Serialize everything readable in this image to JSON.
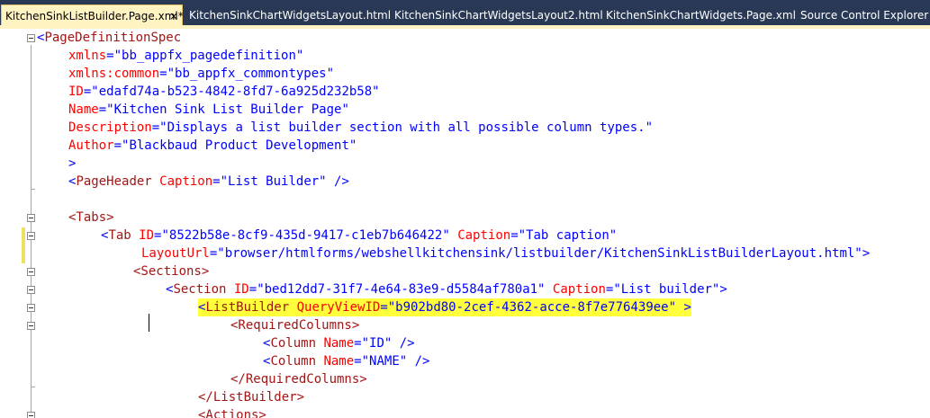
{
  "tabs": [
    {
      "label": "KitchenSinkListBuilder.Page.xml*",
      "active": true
    },
    {
      "label": "KitchenSinkChartWidgetsLayout.html"
    },
    {
      "label": "KitchenSinkChartWidgetsLayout2.html"
    },
    {
      "label": "KitchenSinkChartWidgets.Page.xml"
    },
    {
      "label": "Source Control Explorer"
    }
  ],
  "tab_close_glyph": "×",
  "code": {
    "l1_open": "<",
    "l1_tag": "PageDefinitionSpec",
    "l2_attr": "xmlns",
    "l2_eq": "=",
    "l2_val": "\"bb_appfx_pagedefinition\"",
    "l3_attr": "xmlns:common",
    "l3_eq": "=",
    "l3_val": "\"bb_appfx_commontypes\"",
    "l4_attr": "ID",
    "l4_eq": "=",
    "l4_val": "\"edafd74a-b523-4842-8fd7-6a925d232b58\"",
    "l5_attr": "Name",
    "l5_eq": "=",
    "l5_val": "\"Kitchen Sink List Builder Page\"",
    "l6_attr": "Description",
    "l6_eq": "=",
    "l6_val": "\"Displays a list builder section with all possible column types.\"",
    "l7_attr": "Author",
    "l7_eq": "=",
    "l7_val": "\"Blackbaud Product Development\"",
    "l8_close": ">",
    "l9_open": "<",
    "l9_tag": "PageHeader",
    "l9_attr": " Caption",
    "l9_eq": "=",
    "l9_val": "\"List Builder\"",
    "l9_end": " />",
    "l11_text": "<Tabs>",
    "l12_open": "<",
    "l12_tag": "Tab",
    "l12_attr1": " ID",
    "l12_eq1": "=",
    "l12_val1": "\"8522b58e-8cf9-435d-9417-c1eb7b646422\"",
    "l12_attr2": " Caption",
    "l12_eq2": "=",
    "l12_val2": "\"Tab caption\"",
    "l13_attr": "LayoutUrl",
    "l13_eq": "=",
    "l13_val": "\"browser/htmlforms/webshellkitchensink/listbuilder/KitchenSinkListBuilderLayout.html\"",
    "l13_end": ">",
    "l14_text": "<Sections>",
    "l15_open": "<",
    "l15_tag": "Section",
    "l15_attr1": " ID",
    "l15_eq1": "=",
    "l15_val1": "\"bed12dd7-31f7-4e64-83e9-d5584af780a1\"",
    "l15_attr2": " Caption",
    "l15_eq2": "=",
    "l15_val2": "\"List builder\"",
    "l15_end": ">",
    "l16_open": "<",
    "l16_tag": "ListBuilder",
    "l16_attr": " QueryViewID",
    "l16_eq": "=",
    "l16_val": "\"b902bd80-2cef-4362-acce-8f7e776439ee\"",
    "l16_end": " >",
    "l17_text": "<RequiredColumns>",
    "l18_open": "<",
    "l18_tag": "Column",
    "l18_attr": " Name",
    "l18_eq": "=",
    "l18_val": "\"ID\"",
    "l18_end": " />",
    "l19_open": "<",
    "l19_tag": "Column",
    "l19_attr": " Name",
    "l19_eq": "=",
    "l19_val": "\"NAME\"",
    "l19_end": " />",
    "l20_text": "</RequiredColumns>",
    "l21_text": "</ListBuilder>",
    "l22_text": "<Actions>"
  }
}
